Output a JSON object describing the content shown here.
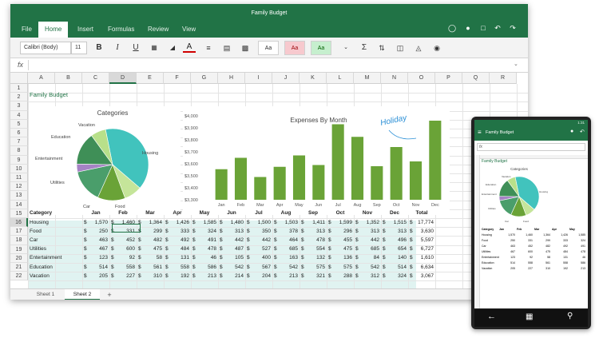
{
  "app_title": "Family Budget",
  "ribbon_tabs": [
    "File",
    "Home",
    "Insert",
    "Formulas",
    "Review",
    "View"
  ],
  "font_name": "Calibri (Body)",
  "font_size": "11",
  "style_labels": [
    "Aa",
    "Aa",
    "Aa"
  ],
  "formula_symbol": "fx",
  "columns": [
    "A",
    "B",
    "C",
    "D",
    "E",
    "F",
    "G",
    "H",
    "I",
    "J",
    "K",
    "L",
    "M",
    "N",
    "O",
    "P",
    "Q",
    "R"
  ],
  "rows": [
    "1",
    "2",
    "3",
    "4",
    "5",
    "6",
    "7",
    "8",
    "9",
    "10",
    "11",
    "12",
    "13",
    "14",
    "15",
    "16",
    "17",
    "18",
    "19",
    "20",
    "21",
    "22"
  ],
  "sheet_title": "Family Budget",
  "table": {
    "header": [
      "Category",
      "Jan",
      "Feb",
      "Mar",
      "Apr",
      "May",
      "Jun",
      "Jul",
      "Aug",
      "Sep",
      "Oct",
      "Nov",
      "Dec",
      "Total"
    ],
    "rows": [
      {
        "cat": "Housing",
        "values": [
          "1,570",
          "1,460",
          "1,364",
          "1,426",
          "1,585",
          "1,480",
          "1,500",
          "1,503",
          "1,411",
          "1,599",
          "1,352",
          "1,515",
          "17,774"
        ]
      },
      {
        "cat": "Food",
        "values": [
          "250",
          "331",
          "299",
          "333",
          "324",
          "313",
          "350",
          "378",
          "313",
          "296",
          "313",
          "313",
          "3,630"
        ]
      },
      {
        "cat": "Car",
        "values": [
          "463",
          "452",
          "482",
          "492",
          "491",
          "442",
          "442",
          "464",
          "478",
          "455",
          "442",
          "496",
          "5,597"
        ]
      },
      {
        "cat": "Utilities",
        "values": [
          "467",
          "600",
          "475",
          "484",
          "478",
          "487",
          "527",
          "685",
          "554",
          "475",
          "685",
          "654",
          "6,727"
        ]
      },
      {
        "cat": "Entertainment",
        "values": [
          "123",
          "92",
          "58",
          "131",
          "46",
          "105",
          "400",
          "163",
          "132",
          "136",
          "84",
          "140",
          "1,610"
        ]
      },
      {
        "cat": "Education",
        "values": [
          "514",
          "558",
          "561",
          "558",
          "586",
          "542",
          "567",
          "542",
          "575",
          "575",
          "542",
          "514",
          "6,634"
        ]
      },
      {
        "cat": "Vacation",
        "values": [
          "205",
          "227",
          "310",
          "192",
          "213",
          "214",
          "204",
          "213",
          "321",
          "288",
          "312",
          "324",
          "3,067"
        ]
      }
    ]
  },
  "pie_title": "Categories",
  "pie_labels": [
    "Housing",
    "Food",
    "Car",
    "Utilities",
    "Entertainment",
    "Education",
    "Vacation"
  ],
  "bar_title": "Expenses By Month",
  "annotation": "Holiday",
  "sheet_tabs": [
    "Sheet 1",
    "Sheet 2"
  ],
  "add_sheet": "+",
  "phone": {
    "time": "1:31",
    "title": "Family Budget",
    "formula_symbol": "fx",
    "sheet_title": "Family Budget",
    "pie_title": "Categories",
    "pie_labels": [
      "Housing",
      "Food",
      "Car",
      "Utilities",
      "Entertainment",
      "Education",
      "Vacation"
    ]
  },
  "colors": {
    "accent": "#217346",
    "teal": "#41c3bd",
    "green": "#6aa337"
  },
  "chart_data": [
    {
      "type": "pie",
      "title": "Categories",
      "categories": [
        "Housing",
        "Food",
        "Car",
        "Utilities",
        "Entertainment",
        "Education",
        "Vacation"
      ],
      "values": [
        17774,
        3630,
        5597,
        6727,
        1610,
        6634,
        3067
      ],
      "colors": [
        "#41c3bd",
        "#c5e59a",
        "#6aa337",
        "#4a9e6b",
        "#a683c5",
        "#3f8f57",
        "#b8e08a"
      ]
    },
    {
      "type": "bar",
      "title": "Expenses By Month",
      "categories": [
        "Jan",
        "Feb",
        "Mar",
        "Apr",
        "May",
        "Jun",
        "Jul",
        "Aug",
        "Sep",
        "Oct",
        "Nov",
        "Dec"
      ],
      "values": [
        3555,
        3650,
        3490,
        3575,
        3670,
        3590,
        3930,
        3825,
        3580,
        3740,
        3620,
        3960
      ],
      "ylim": [
        3300,
        4000
      ],
      "yticks": [
        3300,
        3400,
        3500,
        3600,
        3700,
        3800,
        3900,
        4000
      ],
      "ytick_labels": [
        "$3,300",
        "$3,400",
        "$3,500",
        "$3,600",
        "$3,700",
        "$3,800",
        "$3,900",
        "$4,000"
      ],
      "color": "#6aa337"
    }
  ]
}
